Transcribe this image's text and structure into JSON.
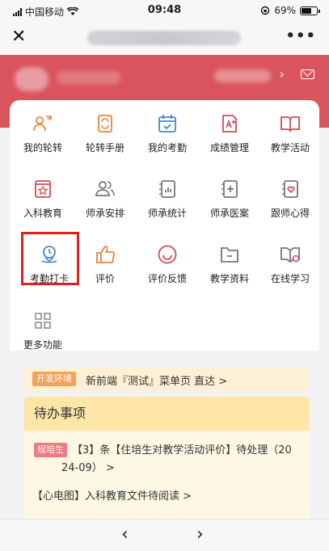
{
  "status_bar": {
    "carrier": "中国移动",
    "time": "09:48",
    "battery": "69%",
    "battery_level": 0.69
  },
  "nav": {
    "close_icon": "close-icon",
    "more": "•••"
  },
  "header": {
    "chevron": "›"
  },
  "menu": [
    {
      "label": "我的轮转",
      "icon": "rotation-icon"
    },
    {
      "label": "轮转手册",
      "icon": "handbook-icon"
    },
    {
      "label": "我的考勤",
      "icon": "calendar-icon"
    },
    {
      "label": "成绩管理",
      "icon": "grade-icon"
    },
    {
      "label": "教学活动",
      "icon": "book-icon"
    },
    {
      "label": "入科教育",
      "icon": "dept-education-icon"
    },
    {
      "label": "师承安排",
      "icon": "people-icon"
    },
    {
      "label": "师承统计",
      "icon": "stats-icon"
    },
    {
      "label": "师承医案",
      "icon": "medical-record-icon"
    },
    {
      "label": "跟师心得",
      "icon": "heart-note-icon"
    },
    {
      "label": "考勤打卡",
      "icon": "location-clock-icon"
    },
    {
      "label": "评价",
      "icon": "thumbs-up-icon"
    },
    {
      "label": "评价反馈",
      "icon": "smile-icon"
    },
    {
      "label": "教学资料",
      "icon": "folder-icon"
    },
    {
      "label": "在线学习",
      "icon": "online-study-icon"
    },
    {
      "label": "更多功能",
      "icon": "grid-icon"
    }
  ],
  "dev_banner": {
    "badge": "开发环境",
    "text": "新前端『测试』菜单页 直达 >"
  },
  "todo": {
    "title": "待办事项",
    "item1_badge": "规培生",
    "item1_line1": "【3】条【住培生对教学活动评价】待处理（20",
    "item1_line2": "24-09） >",
    "item2": "【心电图】入科教育文件待阅读 >"
  },
  "toolbar": {
    "back": "‹",
    "forward": "›"
  },
  "colors": {
    "accent_red": "#d9545d",
    "icon_orange": "#e8843f",
    "icon_blue": "#4a86c8",
    "icon_pink": "#d24b57",
    "icon_gray": "#777777",
    "highlight": "#e02020"
  }
}
